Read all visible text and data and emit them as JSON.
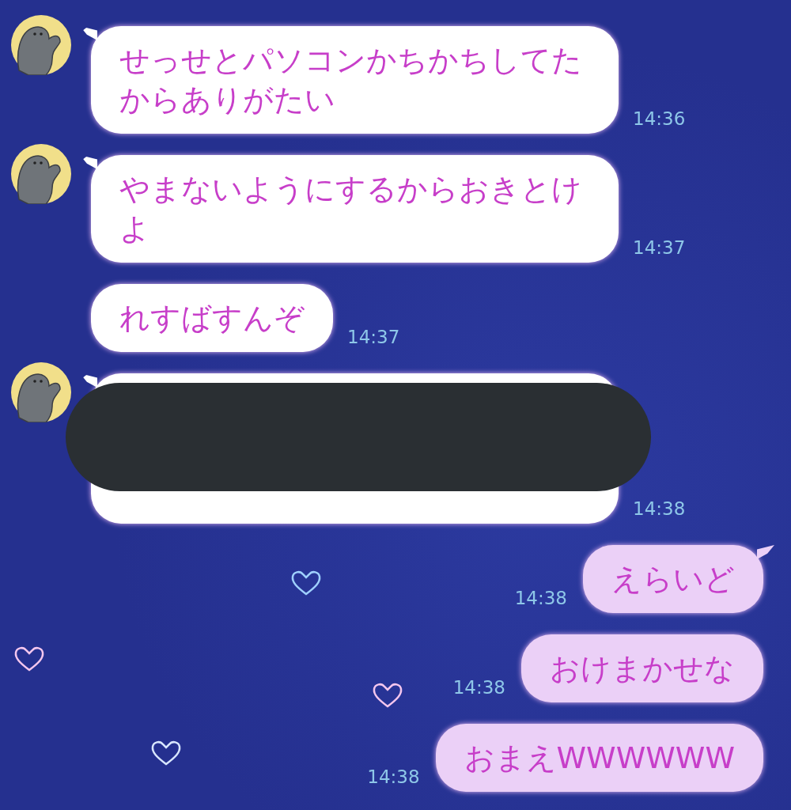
{
  "messages": [
    {
      "kind": "incoming",
      "avatar": true,
      "tail": true,
      "redacted": false,
      "text": "せっせとパソコンかちかちしてたからありがたい",
      "time": "14:36"
    },
    {
      "kind": "incoming",
      "avatar": true,
      "tail": true,
      "redacted": false,
      "text": "やまないようにするからおきとけよ",
      "time": "14:37"
    },
    {
      "kind": "incoming",
      "avatar": false,
      "tail": false,
      "redacted": false,
      "text": "れすばすんぞ",
      "time": "14:37"
    },
    {
      "kind": "incoming",
      "avatar": true,
      "tail": true,
      "redacted": true,
      "time": "14:38"
    },
    {
      "kind": "outgoing",
      "tail": true,
      "redacted": false,
      "text": "えらいど",
      "time": "14:38"
    },
    {
      "kind": "outgoing",
      "tail": false,
      "redacted": false,
      "text": "おけまかせな",
      "time": "14:38"
    },
    {
      "kind": "outgoing",
      "tail": false,
      "redacted": false,
      "text": "おまえWWWWWW",
      "time": "14:38"
    }
  ]
}
